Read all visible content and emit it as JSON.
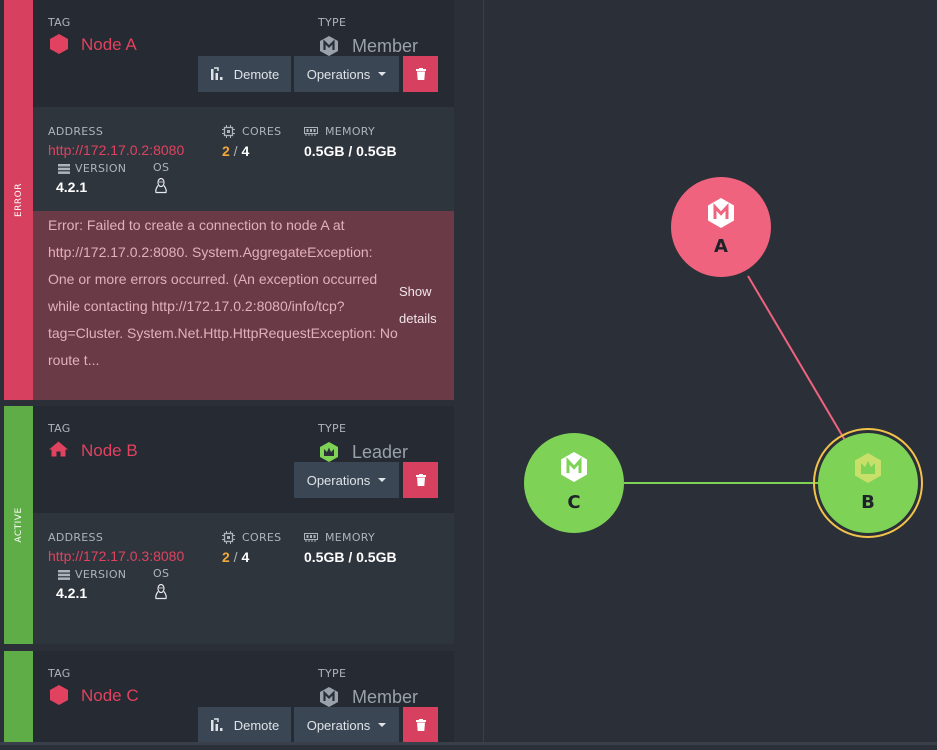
{
  "labels": {
    "tag": "TAG",
    "type": "TYPE",
    "address": "ADDRESS",
    "cores": "CORES",
    "memory": "MEMORY",
    "version": "VERSION",
    "os": "OS"
  },
  "nodes": [
    {
      "status": "ERROR",
      "status_color": "#d8405f",
      "tag": "Node A",
      "tag_icon": "hexagon-icon",
      "type": "Member",
      "type_icon": "member-m-icon",
      "demote_label": "Demote",
      "operations_label": "Operations",
      "address": "http://172.17.0.2:8080",
      "cores_used": "2",
      "cores_total": "4",
      "memory": "0.5GB / 0.5GB",
      "version": "4.2.1",
      "os_icon": "linux-icon",
      "error": "Error: Failed to create a connection to node A at http://172.17.0.2:8080. System.AggregateException: One or more errors occurred. (An exception occurred while contacting http://172.17.0.2:8080/info/tcp?tag=Cluster. System.Net.Http.HttpRequestException: No route t...",
      "show_details": "Show details"
    },
    {
      "status": "ACTIVE",
      "status_color": "#5fad46",
      "tag": "Node B",
      "tag_icon": "home-icon",
      "type": "Leader",
      "type_icon": "leader-crown-icon",
      "operations_label": "Operations",
      "address": "http://172.17.0.3:8080",
      "cores_used": "2",
      "cores_total": "4",
      "memory": "0.5GB / 0.5GB",
      "version": "4.2.1",
      "os_icon": "linux-icon"
    },
    {
      "status": "",
      "status_color": "#5fad46",
      "tag": "Node C",
      "tag_icon": "hexagon-icon",
      "type": "Member",
      "type_icon": "member-m-icon",
      "demote_label": "Demote",
      "operations_label": "Operations"
    }
  ],
  "graph": {
    "nodes": [
      {
        "label": "A",
        "color": "#f0637f",
        "icon": "member-m-icon"
      },
      {
        "label": "B",
        "color": "#7ed357",
        "icon": "leader-crown-icon",
        "ring_color": "#f2c34a"
      },
      {
        "label": "C",
        "color": "#7ed357",
        "icon": "member-m-icon"
      }
    ],
    "edges": [
      {
        "from": "A",
        "to": "B",
        "color": "#f0637f"
      },
      {
        "from": "C",
        "to": "B",
        "color": "#7ed357"
      }
    ]
  }
}
